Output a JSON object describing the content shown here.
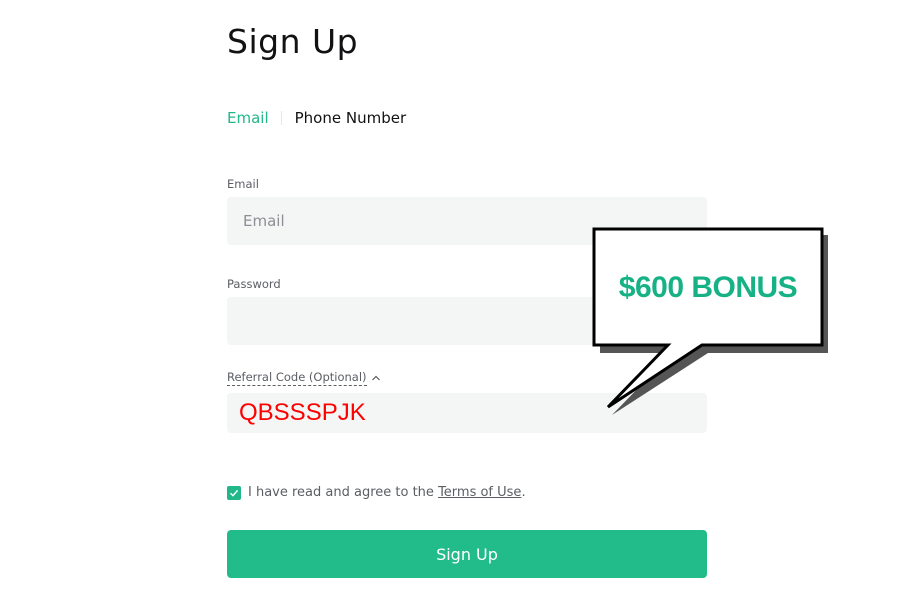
{
  "header": {
    "title": "Sign Up"
  },
  "tabs": [
    {
      "label": "Email",
      "active": true
    },
    {
      "label": "Phone Number",
      "active": false
    }
  ],
  "form": {
    "email_label": "Email",
    "email_placeholder": "Email",
    "password_label": "Password",
    "referral_label": "Referral Code (Optional)",
    "referral_value": "QBSSSPJK",
    "agree_text": "I have read and agree to the ",
    "terms_link": "Terms of Use",
    "agree_suffix": ".",
    "agree_checked": true,
    "submit_label": "Sign Up"
  },
  "promo": {
    "text": "$600 BONUS"
  },
  "colors": {
    "accent": "#22bb8a",
    "promo_text": "#16b286",
    "referral_text": "#ff0000",
    "field_bg": "#f4f6f6"
  },
  "icons": {
    "referral_toggle": "chevron-up-icon",
    "checkbox": "check-icon"
  }
}
